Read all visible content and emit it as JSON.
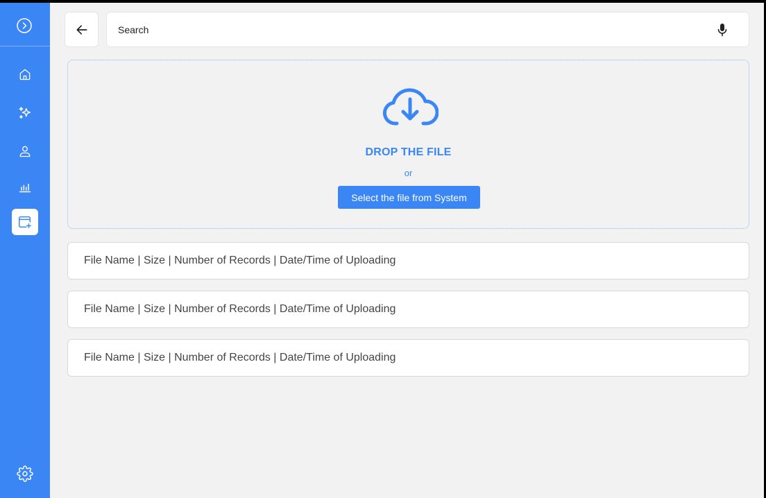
{
  "sidebar": {
    "toggle_icon": "chevron-right-circle-icon",
    "items": [
      {
        "icon": "home-icon",
        "active": false
      },
      {
        "icon": "sparkles-icon",
        "active": false
      },
      {
        "icon": "user-icon",
        "active": false
      },
      {
        "icon": "bar-chart-icon",
        "active": false
      },
      {
        "icon": "add-window-icon",
        "active": true
      }
    ],
    "settings_icon": "gear-icon"
  },
  "header": {
    "back_icon": "arrow-left-icon",
    "search": {
      "placeholder": "Search",
      "value": ""
    },
    "mic_icon": "microphone-icon"
  },
  "upload": {
    "icon": "cloud-download-icon",
    "title": "DROP THE FILE",
    "or": "or",
    "select_button": "Select the file from System"
  },
  "files": [
    {
      "label": "File Name | Size | Number of Records | Date/Time of Uploading"
    },
    {
      "label": "File Name | Size | Number of Records | Date/Time of Uploading"
    },
    {
      "label": "File Name | Size | Number of Records | Date/Time of Uploading"
    }
  ],
  "colors": {
    "accent": "#3a86f5",
    "background": "#f2f2f2"
  }
}
